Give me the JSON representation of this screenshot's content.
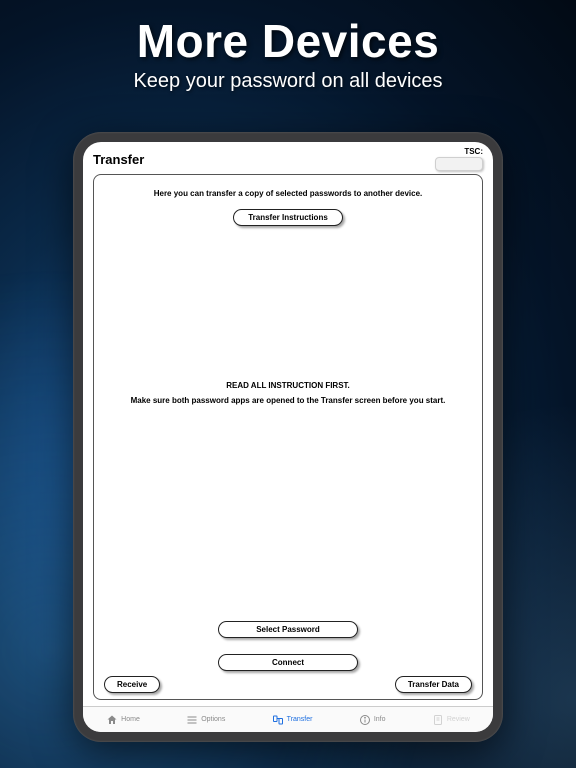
{
  "hero": {
    "title": "More Devices",
    "subtitle": "Keep your password on all devices"
  },
  "topbar": {
    "title": "Transfer",
    "tsc_label": "TSC:",
    "tsc_value": ""
  },
  "panel": {
    "intro": "Here you can transfer a copy of selected passwords to another device.",
    "instructions_btn": "Transfer Instructions",
    "mid_head": "READ ALL INSTRUCTION FIRST.",
    "mid_sub": "Make sure both password apps are opened to the Transfer screen before you start.",
    "select_btn": "Select Password",
    "connect_btn": "Connect",
    "receive_btn": "Receive",
    "transfer_data_btn": "Transfer Data"
  },
  "tabs": {
    "home": "Home",
    "options": "Options",
    "transfer": "Transfer",
    "info": "Info",
    "review": "Review"
  }
}
